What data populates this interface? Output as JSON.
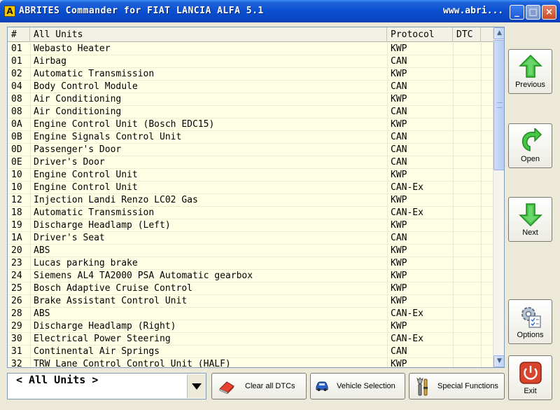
{
  "window": {
    "icon_letter": "A",
    "title": "ABRITES Commander for FIAT LANCIA ALFA 5.1",
    "url": "www.abri...",
    "minimize": "_",
    "maximize": "□",
    "close": "×"
  },
  "table": {
    "columns": {
      "num": "#",
      "name": "All Units",
      "protocol": "Protocol",
      "dtc": "DTC"
    },
    "rows": [
      {
        "num": "01",
        "name": "Webasto Heater",
        "protocol": "KWP",
        "dtc": ""
      },
      {
        "num": "01",
        "name": "Airbag",
        "protocol": "CAN",
        "dtc": ""
      },
      {
        "num": "02",
        "name": "Automatic Transmission",
        "protocol": "KWP",
        "dtc": ""
      },
      {
        "num": "04",
        "name": "Body Control Module",
        "protocol": "CAN",
        "dtc": ""
      },
      {
        "num": "08",
        "name": "Air Conditioning",
        "protocol": "KWP",
        "dtc": ""
      },
      {
        "num": "08",
        "name": "Air Conditioning",
        "protocol": "CAN",
        "dtc": ""
      },
      {
        "num": "0A",
        "name": "Engine Control Unit (Bosch EDC15)",
        "protocol": "KWP",
        "dtc": ""
      },
      {
        "num": "0B",
        "name": "Engine Signals Control Unit",
        "protocol": "CAN",
        "dtc": ""
      },
      {
        "num": "0D",
        "name": "Passenger's Door",
        "protocol": "CAN",
        "dtc": ""
      },
      {
        "num": "0E",
        "name": "Driver's Door",
        "protocol": "CAN",
        "dtc": ""
      },
      {
        "num": "10",
        "name": "Engine Control Unit",
        "protocol": "KWP",
        "dtc": ""
      },
      {
        "num": "10",
        "name": "Engine Control Unit",
        "protocol": "CAN-Ex",
        "dtc": ""
      },
      {
        "num": "12",
        "name": "Injection Landi Renzo LC02 Gas",
        "protocol": "KWP",
        "dtc": ""
      },
      {
        "num": "18",
        "name": "Automatic Transmission",
        "protocol": "CAN-Ex",
        "dtc": ""
      },
      {
        "num": "19",
        "name": "Discharge Headlamp (Left)",
        "protocol": "KWP",
        "dtc": ""
      },
      {
        "num": "1A",
        "name": "Driver's Seat",
        "protocol": "CAN",
        "dtc": ""
      },
      {
        "num": "20",
        "name": "ABS",
        "protocol": "KWP",
        "dtc": ""
      },
      {
        "num": "23",
        "name": "Lucas parking brake",
        "protocol": "KWP",
        "dtc": ""
      },
      {
        "num": "24",
        "name": "Siemens AL4 TA2000 PSA Automatic gearbox",
        "protocol": "KWP",
        "dtc": ""
      },
      {
        "num": "25",
        "name": "Bosch Adaptive Cruise Control",
        "protocol": "KWP",
        "dtc": ""
      },
      {
        "num": "26",
        "name": "Brake Assistant Control Unit",
        "protocol": "KWP",
        "dtc": ""
      },
      {
        "num": "28",
        "name": "ABS",
        "protocol": "CAN-Ex",
        "dtc": ""
      },
      {
        "num": "29",
        "name": "Discharge Headlamp (Right)",
        "protocol": "KWP",
        "dtc": ""
      },
      {
        "num": "30",
        "name": "Electrical Power Steering",
        "protocol": "CAN-Ex",
        "dtc": ""
      },
      {
        "num": "31",
        "name": "Continental Air Springs",
        "protocol": "CAN",
        "dtc": ""
      },
      {
        "num": "32",
        "name": "TRW Lane Control Control Unit (HALF)",
        "protocol": "KWP",
        "dtc": ""
      }
    ]
  },
  "side_buttons": {
    "previous": "Previous",
    "open": "Open",
    "next": "Next",
    "options": "Options",
    "exit": "Exit"
  },
  "bottom": {
    "selector_value": "< All Units >",
    "clear_dtcs": "Clear all DTCs",
    "vehicle_selection": "Vehicle Selection",
    "special_functions": "Special Functions"
  },
  "colors": {
    "table_bg": "#ffffe6",
    "titlebar": "#0a4fd0",
    "arrow_green": "#3fbf3f",
    "exit_red": "#d8452f"
  }
}
